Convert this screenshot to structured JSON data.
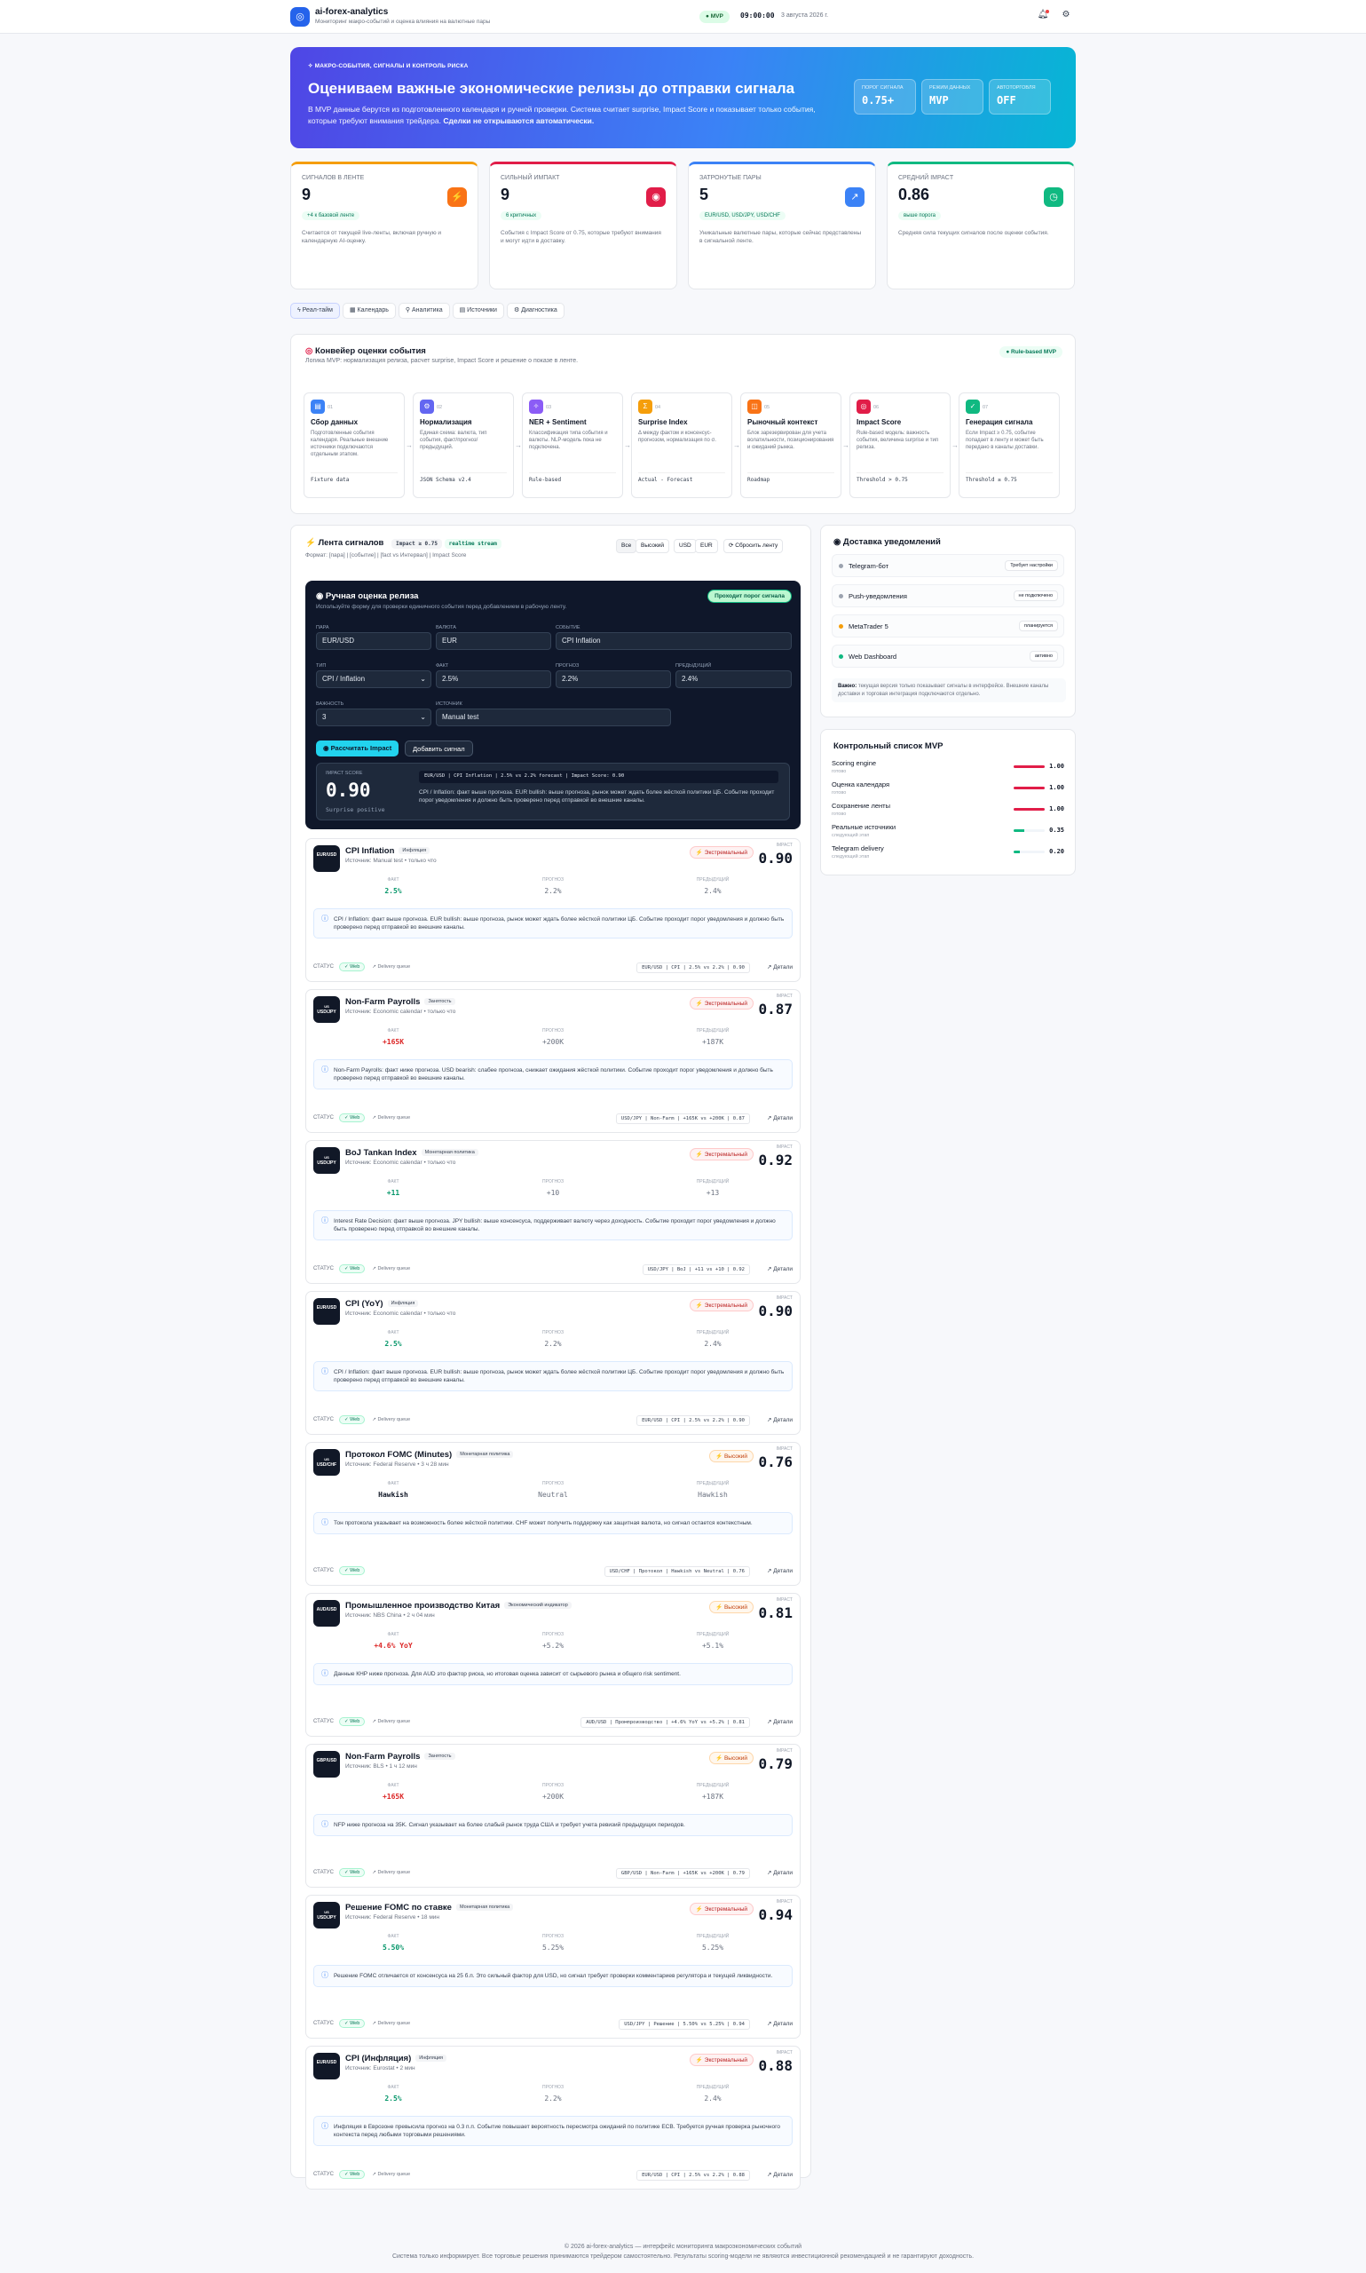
{
  "header": {
    "brand": "ai-forex-analytics",
    "tagline": "Мониторинг макро-событий и оценка влияния на валютные пары",
    "mvp": "● MVP",
    "clock": "09:00:00",
    "date": "3 августа 2026 г."
  },
  "hero": {
    "badge": "МАКРО-СОБЫТИЯ, СИГНАЛЫ И КОНТРОЛЬ РИСКА",
    "title": "Оцениваем важные экономические релизы до отправки сигнала",
    "text": "В MVP данные берутся из подготовленного календаря и ручной проверки. Система считает surprise, Impact Score и показывает только события, которые требуют внимания трейдера. ",
    "text_bold": "Сделки не открываются автоматически.",
    "stats": [
      {
        "label": "ПОРОГ СИГНАЛА",
        "value": "0.75+"
      },
      {
        "label": "РЕЖИМ ДАННЫХ",
        "value": "MVP"
      },
      {
        "label": "АВТОТОРГОВЛЯ",
        "value": "OFF"
      }
    ]
  },
  "kpis": [
    {
      "label": "СИГНАЛОВ В ЛЕНТЕ",
      "value": "9",
      "pill": "+4 к базовой ленте",
      "desc": "Считается от текущей live-ленты, включая ручную и календарную AI-оценку.",
      "color": "#f59e0b",
      "icon": "⚡"
    },
    {
      "label": "СИЛЬНЫЙ ИМПАКТ",
      "value": "9",
      "pill": "6 критичных",
      "desc": "События с Impact Score от 0.75, которые требуют внимания и могут идти в доставку.",
      "color": "#e11d48",
      "icon": "◉"
    },
    {
      "label": "ЗАТРОНУТЫЕ ПАРЫ",
      "value": "5",
      "pill": "EUR/USD, USD/JPY, USD/CHF",
      "desc": "Уникальные валютные пары, которые сейчас представлены в сигнальной ленте.",
      "color": "#3b82f6",
      "icon": "↗"
    },
    {
      "label": "СРЕДНИЙ IMPACT",
      "value": "0.86",
      "pill": "выше порога",
      "desc": "Средняя сила текущих сигналов после оценки события.",
      "color": "#10b981",
      "icon": "◷"
    }
  ],
  "tabs": [
    "Реал-тайм",
    "Календарь",
    "Аналитика",
    "Источники",
    "Диагностика"
  ],
  "pipeline": {
    "title": "Конвейер оценки события",
    "sub": "Логика MVP: нормализация релиза, расчет surprise, Impact Score и решение о показе в ленте.",
    "badge": "● Rule-based MVP",
    "stages": [
      {
        "n": "01",
        "title": "Сбор данных",
        "desc": "Подготовленные события календаря. Реальные внешние источники подключаются отдельным этапом.",
        "meta": "Fixture data",
        "color": "#3b82f6",
        "icon": "▤"
      },
      {
        "n": "02",
        "title": "Нормализация",
        "desc": "Единая схема: валюта, тип события, факт/прогноз/предыдущий.",
        "meta": "JSON Schema v2.4",
        "color": "#6366f1",
        "icon": "⚙"
      },
      {
        "n": "03",
        "title": "NER + Sentiment",
        "desc": "Классификация типа события и валюты. NLP-модель пока не подключена.",
        "meta": "Rule-based",
        "color": "#8b5cf6",
        "icon": "✧"
      },
      {
        "n": "04",
        "title": "Surprise Index",
        "desc": "Δ между фактом и консенсус-прогнозом, нормализация по σ.",
        "meta": "Actual - Forecast",
        "color": "#f59e0b",
        "icon": "Σ"
      },
      {
        "n": "05",
        "title": "Рыночный контекст",
        "desc": "Блок зарезервирован для учета волатильности, позиционирования и ожиданий рынка.",
        "meta": "Roadmap",
        "color": "#f97316",
        "icon": "◫"
      },
      {
        "n": "06",
        "title": "Impact Score",
        "desc": "Rule-based модель: важность события, величина surprise и тип релиза.",
        "meta": "Threshold > 0.75",
        "color": "#e11d48",
        "icon": "◎"
      },
      {
        "n": "07",
        "title": "Генерация сигнала",
        "desc": "Если Impact ≥ 0.75, событие попадает в ленту и может быть передано в каналы доставки.",
        "meta": "Threshold ≥ 0.75",
        "color": "#10b981",
        "icon": "✓"
      }
    ]
  },
  "feed": {
    "title": "Лента сигналов",
    "chip1": "Impact ≥ 0.75",
    "chip2": "realtime stream",
    "format": "Формат: [пара] | [событие] | [fact vs Интервал] | Impact Score",
    "filters": [
      "Все",
      "Высокий",
      "USD",
      "EUR"
    ],
    "reset": "⟳ Сбросить ленту"
  },
  "manual": {
    "title": "◉ Ручная оценка релиза",
    "sub": "Используйте форму для проверки единичного события перед добавлением в рабочую ленту.",
    "pass": "Проходит порог сигнала",
    "labels": {
      "pair": "ПАРА",
      "currency": "ВАЛЮТА",
      "event": "СОБЫТИЕ",
      "type": "ТИП",
      "fact": "ФАКТ",
      "forecast": "ПРОГНОЗ",
      "previous": "ПРЕДЫДУЩИЙ",
      "importance": "ВАЖНОСТЬ",
      "source": "ИСТОЧНИК"
    },
    "values": {
      "pair": "EUR/USD",
      "currency": "EUR",
      "event": "CPI Inflation",
      "type": "CPI / Inflation",
      "fact": "2.5%",
      "forecast": "2.2%",
      "previous": "2.4%",
      "importance": "3",
      "source": "Manual test"
    },
    "btn_calc": "◉ Рассчитать Impact",
    "btn_add": "Добавить сигнал",
    "res_label": "IMPACT SCORE",
    "res_value": "0.90",
    "res_sub": "Surprise positive",
    "res_line": "EUR/USD | CPI Inflation | 2.5% vs 2.2% forecast | Impact Score: 0.90",
    "res_text": "CPI / Inflation: факт выше прогноза. EUR bullish: выше прогноза, рынок может ждать более жёсткой политики ЦБ. Событие проходит порог уведомления и должно быть проверено перед отправкой во внешние каналы."
  },
  "col_labels": {
    "fact": "ФАКТ",
    "forecast": "ПРОГНОЗ",
    "previous": "ПРЕДЫДУЩИЙ",
    "impact": "IMPACT",
    "status": "СТАТУС",
    "details": "↗ Детали"
  },
  "signals": [
    {
      "pair": "EUR/USD",
      "name": "CPI Inflation",
      "tag": "Инфляция",
      "src": "Источник: Manual test • только что",
      "sev": "⚡ Экстремальный",
      "sev_level": "extreme",
      "impact": "0.90",
      "fact": "2.5%",
      "forecast": "2.2%",
      "previous": "2.4%",
      "fact_color": "#059669",
      "note": "CPI / Inflation: факт выше прогноза. EUR bullish: выше прогноза, рынок может ждать более жёсткой политики ЦБ. Событие проходит порог уведомления и должно быть проверено перед отправкой во внешние каналы.",
      "status": "Web",
      "delivery": "Delivery queue",
      "meta": "EUR/USD | CPI | 2.5% vs 2.2% | 0.90"
    },
    {
      "pair": "USD/JPY",
      "name": "Non-Farm Payrolls",
      "tag": "Занятость",
      "src": "Источник: Economic calendar • только что",
      "sev": "⚡ Экстремальный",
      "sev_level": "extreme",
      "impact": "0.87",
      "fact": "+165K",
      "forecast": "+200K",
      "previous": "+187K",
      "fact_color": "#dc2626",
      "note": "Non-Farm Payrolls: факт ниже прогноза. USD bearish: слабее прогноза, снижает ожидания жёсткой политики. Событие проходит порог уведомления и должно быть проверено перед отправкой во внешние каналы.",
      "status": "Web",
      "delivery": "Delivery queue",
      "meta": "USD/JPY | Non-Farm | +165K vs +200K | 0.87"
    },
    {
      "pair": "USD/JPY",
      "name": "BoJ Tankan Index",
      "tag": "Монетарная политика",
      "src": "Источник: Economic calendar • только что",
      "sev": "⚡ Экстремальный",
      "sev_level": "extreme",
      "impact": "0.92",
      "fact": "+11",
      "forecast": "+10",
      "previous": "+13",
      "fact_color": "#059669",
      "note": "Interest Rate Decision: факт выше прогноза. JPY bullish: выше консенсуса, поддерживает валюту через доходность. Событие проходит порог уведомления и должно быть проверено перед отправкой во внешние каналы.",
      "status": "Web",
      "delivery": "Delivery queue",
      "meta": "USD/JPY | BoJ | +11 vs +10 | 0.92"
    },
    {
      "pair": "EUR/USD",
      "name": "CPI (YoY)",
      "tag": "Инфляция",
      "src": "Источник: Economic calendar • только что",
      "sev": "⚡ Экстремальный",
      "sev_level": "extreme",
      "impact": "0.90",
      "fact": "2.5%",
      "forecast": "2.2%",
      "previous": "2.4%",
      "fact_color": "#059669",
      "note": "CPI / Inflation: факт выше прогноза. EUR bullish: выше прогноза, рынок может ждать более жёсткой политики ЦБ. Событие проходит порог уведомления и должно быть проверено перед отправкой во внешние каналы.",
      "status": "Web",
      "delivery": "Delivery queue",
      "meta": "EUR/USD | CPI | 2.5% vs 2.2% | 0.90"
    },
    {
      "pair": "USD/CHF",
      "name": "Протокол FOMC (Minutes)",
      "tag": "Монетарная политика",
      "src": "Источник: Federal Reserve • 3 ч 28 мин",
      "sev": "⚡ Высокий",
      "sev_level": "high",
      "impact": "0.76",
      "fact": "Hawkish",
      "forecast": "Neutral",
      "previous": "Hawkish",
      "fact_color": "#111827",
      "note": "Тон протокола указывает на возможность более жёсткой политики. CHF может получить поддержку как защитная валюта, но сигнал остается контекстным.",
      "status": "Web",
      "delivery": "",
      "meta": "USD/CHF | Протокол | Hawkish vs Neutral | 0.76"
    },
    {
      "pair": "AUD/USD",
      "name": "Промышленное производство Китая",
      "tag": "Экономический индикатор",
      "src": "Источник: NBS China • 2 ч 04 мин",
      "sev": "⚡ Высокий",
      "sev_level": "high",
      "impact": "0.81",
      "fact": "+4.6% YoY",
      "forecast": "+5.2%",
      "previous": "+5.1%",
      "fact_color": "#dc2626",
      "note": "Данные КНР ниже прогноза. Для AUD это фактор риска, но итоговая оценка зависит от сырьевого рынка и общего risk sentiment.",
      "status": "Web",
      "delivery": "Delivery queue",
      "meta": "AUD/USD | Промпроизводство | +4.6% YoY vs +5.2% | 0.81"
    },
    {
      "pair": "GBP/USD",
      "name": "Non-Farm Payrolls",
      "tag": "Занятость",
      "src": "Источник: BLS • 1 ч 12 мин",
      "sev": "⚡ Высокий",
      "sev_level": "high",
      "impact": "0.79",
      "fact": "+165K",
      "forecast": "+200K",
      "previous": "+187K",
      "fact_color": "#dc2626",
      "note": "NFP ниже прогноза на 35K. Сигнал указывает на более слабый рынок труда США и требует учета ревизий предыдущих периодов.",
      "status": "Web",
      "delivery": "Delivery queue",
      "meta": "GBP/USD | Non-Farm | +165K vs +200K | 0.79"
    },
    {
      "pair": "USD/JPY",
      "name": "Решение FOMC по ставке",
      "tag": "Монетарная политика",
      "src": "Источник: Federal Reserve • 18 мин",
      "sev": "⚡ Экстремальный",
      "sev_level": "extreme",
      "impact": "0.94",
      "fact": "5.50%",
      "forecast": "5.25%",
      "previous": "5.25%",
      "fact_color": "#059669",
      "note": "Решение FOMC отличается от консенсуса на 25 б.п. Это сильный фактор для USD, но сигнал требует проверки комментариев регулятора и текущей ликвидности.",
      "status": "Web",
      "delivery": "Delivery queue",
      "meta": "USD/JPY | Решение | 5.50% vs 5.25% | 0.94"
    },
    {
      "pair": "EUR/USD",
      "name": "CPI (Инфляция)",
      "tag": "Инфляция",
      "src": "Источник: Eurostat • 2 мин",
      "sev": "⚡ Экстремальный",
      "sev_level": "extreme",
      "impact": "0.88",
      "fact": "2.5%",
      "forecast": "2.2%",
      "previous": "2.4%",
      "fact_color": "#059669",
      "note": "Инфляция в Еврозоне превысила прогноз на 0.3 п.п. Событие повышает вероятность пересмотра ожиданий по политике ECB. Требуется ручная проверка рыночного контекста перед любыми торговыми решениями.",
      "status": "Web",
      "delivery": "Delivery queue",
      "meta": "EUR/USD | CPI | 2.5% vs 2.2% | 0.88"
    }
  ],
  "delivery": {
    "title": "◉ Доставка уведомлений",
    "items": [
      {
        "name": "Telegram-бот",
        "status": "Требует настройки",
        "dot": "#9ca3af"
      },
      {
        "name": "Push-уведомления",
        "status": "не подключено",
        "dot": "#9ca3af"
      },
      {
        "name": "MetaTrader 5",
        "status": "планируется",
        "dot": "#f59e0b"
      },
      {
        "name": "Web Dashboard",
        "status": "активно",
        "dot": "#10b981"
      }
    ],
    "note_b": "Важно: ",
    "note": "текущая версия только показывает сигналы в интерфейсе. Внешние каналы доставки и торговая интеграция подключаются отдельно."
  },
  "checklist": {
    "title": "Контрольный список MVP",
    "items": [
      {
        "name": "Scoring engine",
        "sub": "готово",
        "pct": "1.00",
        "fill": 1.0,
        "color": "#e11d48"
      },
      {
        "name": "Оценка календаря",
        "sub": "готово",
        "pct": "1.00",
        "fill": 1.0,
        "color": "#e11d48"
      },
      {
        "name": "Сохранение ленты",
        "sub": "готово",
        "pct": "1.00",
        "fill": 1.0,
        "color": "#e11d48"
      },
      {
        "name": "Реальные источники",
        "sub": "следующий этап",
        "pct": "0.35",
        "fill": 0.35,
        "color": "#10b981"
      },
      {
        "name": "Telegram delivery",
        "sub": "следующий этап",
        "pct": "0.20",
        "fill": 0.2,
        "color": "#10b981"
      }
    ]
  },
  "footer": {
    "line1": "© 2026 ai-forex-analytics — интерфейс мониторинга макроэкономических событий",
    "line2": "Система только информирует. Все торговые решения принимаются трейдером самостоятельно. Результаты scoring-модели не являются инвестиционной рекомендацией и не гарантируют доходность."
  }
}
